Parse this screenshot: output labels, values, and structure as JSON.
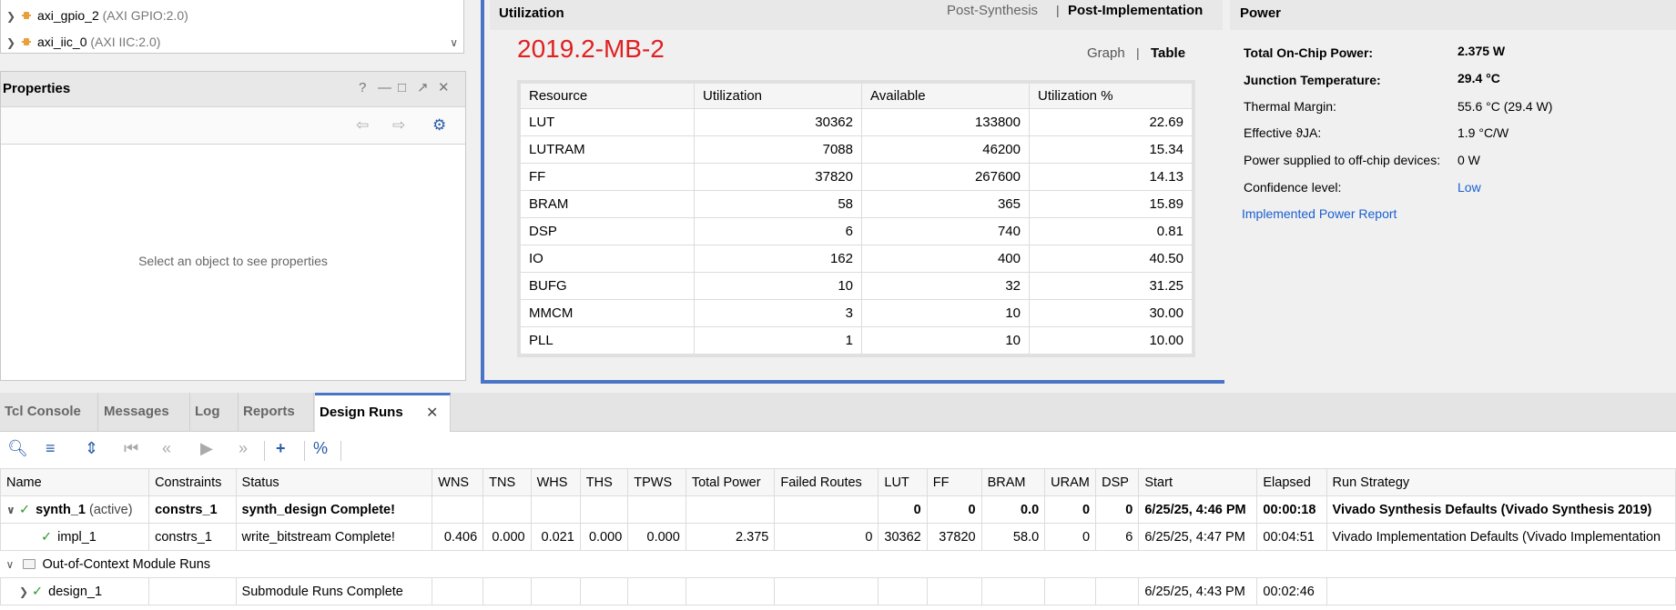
{
  "tree": {
    "items": [
      {
        "name": "axi_gpio_2",
        "sub": "(AXI GPIO:2.0)"
      },
      {
        "name": "axi_iic_0",
        "sub": "(AXI IIC:2.0)"
      }
    ]
  },
  "properties": {
    "title": "Properties",
    "empty_message": "Select an object to see properties",
    "header_icons": [
      "help-icon",
      "minimize-icon",
      "maximize-icon",
      "float-icon",
      "close-icon"
    ],
    "toolbar_icons": [
      "back-icon",
      "forward-icon",
      "gear-icon"
    ]
  },
  "utilization": {
    "title": "Utilization",
    "tabs": [
      "Post-Synthesis",
      "Post-Implementation"
    ],
    "active_tab": "Post-Implementation",
    "subtitle": "2019.2-MB-2",
    "views": [
      "Graph",
      "Table"
    ],
    "active_view": "Table",
    "columns": [
      "Resource",
      "Utilization",
      "Available",
      "Utilization %"
    ],
    "rows": [
      [
        "LUT",
        "30362",
        "133800",
        "22.69"
      ],
      [
        "LUTRAM",
        "7088",
        "46200",
        "15.34"
      ],
      [
        "FF",
        "37820",
        "267600",
        "14.13"
      ],
      [
        "BRAM",
        "58",
        "365",
        "15.89"
      ],
      [
        "DSP",
        "6",
        "740",
        "0.81"
      ],
      [
        "IO",
        "162",
        "400",
        "40.50"
      ],
      [
        "BUFG",
        "10",
        "32",
        "31.25"
      ],
      [
        "MMCM",
        "3",
        "10",
        "30.00"
      ],
      [
        "PLL",
        "1",
        "10",
        "10.00"
      ]
    ]
  },
  "power": {
    "title": "Power",
    "rows": [
      {
        "label": "Total On-Chip Power:",
        "value": "2.375 W",
        "bold": true
      },
      {
        "label": "Junction Temperature:",
        "value": "29.4 °C",
        "bold": true
      },
      {
        "label": "Thermal Margin:",
        "value": "55.6 °C (29.4 W)",
        "bold": false
      },
      {
        "label": "Effective ϑJA:",
        "value": "1.9 °C/W",
        "bold": false
      },
      {
        "label": "Power supplied to off-chip devices:",
        "value": "0 W",
        "bold": false
      },
      {
        "label": "Confidence level:",
        "value": "Low",
        "bold": false,
        "link": true
      }
    ],
    "report_link": "Implemented Power Report"
  },
  "bottom": {
    "tabs": [
      "Tcl Console",
      "Messages",
      "Log",
      "Reports",
      "Design Runs"
    ],
    "active_tab": "Design Runs",
    "toolbar_icons": [
      "search-icon",
      "collapse-all-icon",
      "expand-all-icon",
      "first-icon",
      "previous-icon",
      "run-icon",
      "next-icon",
      "add-icon",
      "percent-icon"
    ]
  },
  "runs": {
    "columns": [
      "Name",
      "Constraints",
      "Status",
      "WNS",
      "TNS",
      "WHS",
      "THS",
      "TPWS",
      "Total Power",
      "Failed Routes",
      "LUT",
      "FF",
      "BRAM",
      "URAM",
      "DSP",
      "Start",
      "Elapsed",
      "Run Strategy"
    ],
    "synth": {
      "name": "synth_1",
      "state": "(active)",
      "constraints": "constrs_1",
      "status": "synth_design Complete!",
      "wns": "",
      "tns": "",
      "whs": "",
      "ths": "",
      "tpws": "",
      "total_power": "",
      "failed_routes": "",
      "lut": "0",
      "ff": "0",
      "bram": "0.0",
      "uram": "0",
      "dsp": "0",
      "start": "6/25/25, 4:46 PM",
      "elapsed": "00:00:18",
      "strategy": "Vivado Synthesis Defaults (Vivado Synthesis 2019)"
    },
    "impl": {
      "name": "impl_1",
      "constraints": "constrs_1",
      "status": "write_bitstream Complete!",
      "wns": "0.406",
      "tns": "0.000",
      "whs": "0.021",
      "ths": "0.000",
      "tpws": "0.000",
      "total_power": "2.375",
      "failed_routes": "0",
      "lut": "30362",
      "ff": "37820",
      "bram": "58.0",
      "uram": "0",
      "dsp": "6",
      "start": "6/25/25, 4:47 PM",
      "elapsed": "00:04:51",
      "strategy": "Vivado Implementation Defaults (Vivado Implementation"
    },
    "ooc": {
      "label": "Out-of-Context Module Runs"
    },
    "design": {
      "name": "design_1",
      "status": "Submodule Runs Complete",
      "start": "6/25/25, 4:43 PM",
      "elapsed": "00:02:46"
    }
  },
  "colors": {
    "accent": "#4a75c6",
    "subtitle": "#e02020",
    "check": "#2a9a2a",
    "link": "#1a5fd0"
  }
}
